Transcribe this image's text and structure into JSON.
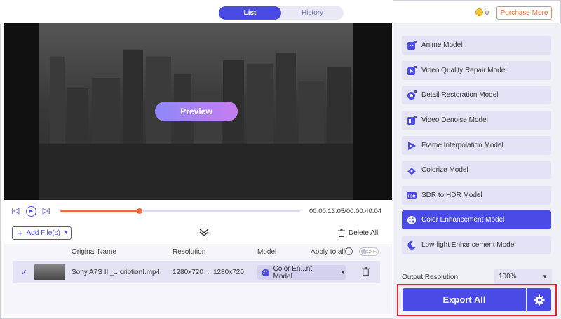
{
  "tabs": {
    "list": "List",
    "history": "History"
  },
  "credits": "0",
  "purchase_label": "Purchase More",
  "preview_label": "Preview",
  "playback": {
    "time": "00:00:13.05/00:00:40.04",
    "progress": 0.33
  },
  "file_controls": {
    "add_label": "Add File(s)",
    "delete_all_label": "Delete All"
  },
  "table": {
    "headers": {
      "name": "Original Name",
      "resolution": "Resolution",
      "model": "Model",
      "apply_all": "Apply to all",
      "toggle": "OFF"
    },
    "rows": [
      {
        "name": "Sony A7S II _...cription!.mp4",
        "res_in": "1280x720",
        "res_out": "1280x720",
        "model": "Color En...nt Model"
      }
    ]
  },
  "models": [
    {
      "label": "Anime Model",
      "icon": "anime-icon"
    },
    {
      "label": "Video Quality Repair Model",
      "icon": "video-repair-icon"
    },
    {
      "label": "Detail Restoration Model",
      "icon": "detail-restoration-icon"
    },
    {
      "label": "Video Denoise Model",
      "icon": "denoise-icon"
    },
    {
      "label": "Frame Interpolation Model",
      "icon": "frame-interpolation-icon"
    },
    {
      "label": "Colorize Model",
      "icon": "colorize-icon"
    },
    {
      "label": "SDR to HDR Model",
      "icon": "hdr-icon"
    },
    {
      "label": "Color Enhancement Model",
      "icon": "palette-icon",
      "selected": true
    },
    {
      "label": "Low-light Enhancement Model",
      "icon": "moon-icon"
    }
  ],
  "output": {
    "label": "Output Resolution",
    "value": "100%"
  },
  "export_label": "Export All",
  "colors": {
    "accent": "#4a4ae6",
    "orange": "#ee6a3e",
    "highlight": "#e8202a"
  }
}
